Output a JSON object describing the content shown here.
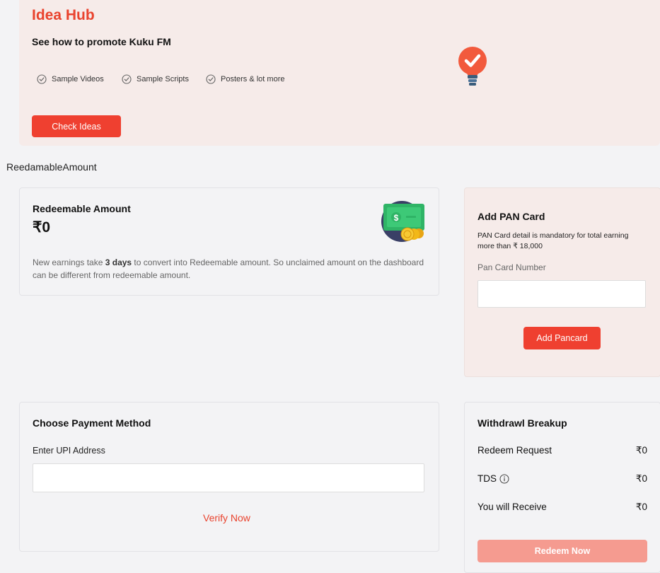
{
  "idea_hub": {
    "title": "Idea Hub",
    "subtitle": "See how to promote Kuku FM",
    "features": [
      "Sample Videos",
      "Sample Scripts",
      "Posters & lot more"
    ],
    "button_label": "Check Ideas"
  },
  "section_label": "ReedamableAmount",
  "redeemable": {
    "title": "Redeemable Amount",
    "amount": "₹0",
    "note_prefix": "New earnings take ",
    "note_bold": "3 days",
    "note_suffix": " to convert into Redeemable amount. So unclaimed amount on the dashboard can be different from redeemable amount."
  },
  "pan": {
    "title": "Add PAN Card",
    "note": "PAN Card detail is mandatory for total earning more than ₹ 18,000",
    "field_label": "Pan Card Number",
    "field_value": "",
    "button_label": "Add Pancard"
  },
  "payment": {
    "title": "Choose Payment Method",
    "field_label": "Enter UPI Address",
    "field_value": "",
    "verify_label": "Verify Now"
  },
  "withdrawl": {
    "title": "Withdrawl Breakup",
    "rows": [
      {
        "label": "Redeem Request",
        "value": "₹0"
      },
      {
        "label": "TDS",
        "value": "₹0"
      },
      {
        "label": "You will Receive",
        "value": "₹0"
      }
    ],
    "button_label": "Redeem Now"
  },
  "colors": {
    "accent": "#ef4030",
    "accent_disabled": "#f59b90",
    "card_tint": "#f6ebe9",
    "page_bg": "#f3f3f5"
  },
  "icons": [
    "check-circle-icon",
    "lightbulb-icon",
    "money-coins-icon",
    "info-icon"
  ]
}
